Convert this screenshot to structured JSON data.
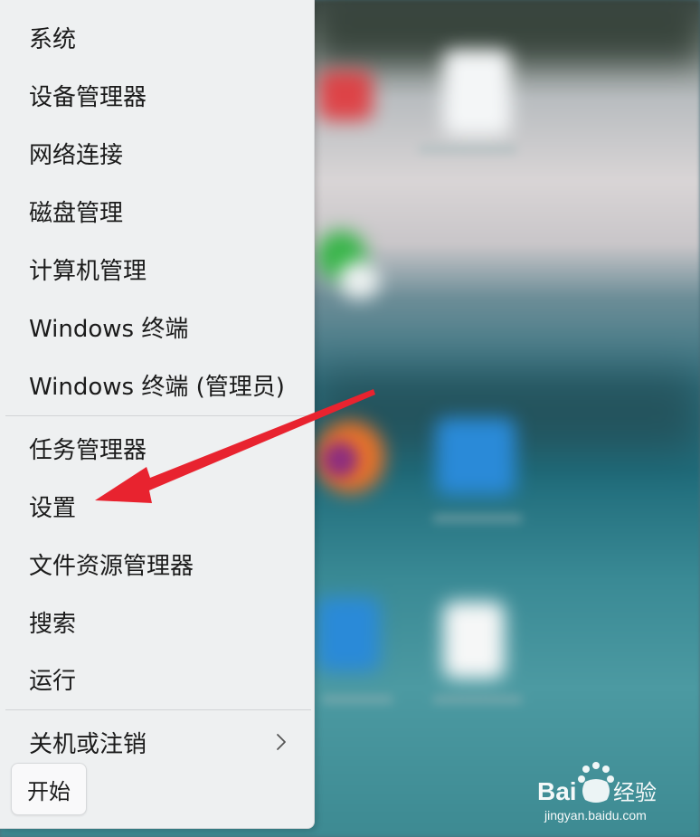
{
  "menu": {
    "items": [
      {
        "label": "系统"
      },
      {
        "label": "设备管理器"
      },
      {
        "label": "网络连接"
      },
      {
        "label": "磁盘管理"
      },
      {
        "label": "计算机管理"
      },
      {
        "label": "Windows 终端"
      },
      {
        "label": "Windows 终端 (管理员)"
      },
      {
        "label": "任务管理器"
      },
      {
        "label": "设置"
      },
      {
        "label": "文件资源管理器"
      },
      {
        "label": "搜索"
      },
      {
        "label": "运行"
      },
      {
        "label": "关机或注销"
      }
    ]
  },
  "start_button": {
    "label": "开始"
  },
  "watermark": {
    "brand": "Bai",
    "brand_suffix": "经验",
    "url": "jingyan.baidu.com"
  },
  "colors": {
    "menu_background": "#eef0f1",
    "annotation_arrow": "#e8232f"
  }
}
